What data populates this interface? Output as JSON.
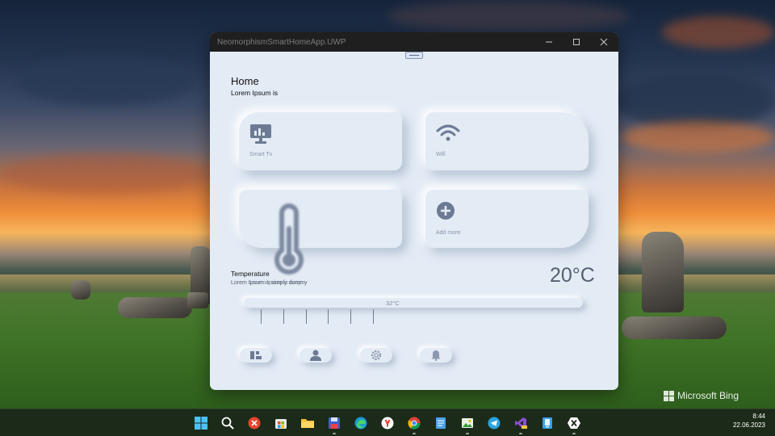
{
  "window": {
    "title": "NeomorphismSmartHomeApp.UWP",
    "controls": [
      "minimize-icon",
      "maximize-icon",
      "close-icon"
    ]
  },
  "page": {
    "title": "Home",
    "subtitle": "Lorem Ipsum is"
  },
  "cards": [
    {
      "label": "Smart Tv",
      "icon": "monitor-chart-icon"
    },
    {
      "label": "Wifi",
      "icon": "wifi-icon"
    },
    {
      "label": "",
      "icon": "thermometer-icon"
    },
    {
      "label": "Add more",
      "icon": "plus-circle-icon"
    }
  ],
  "temperature": {
    "title": "Temperature",
    "description": "Lorem Ipsum is simply dummy",
    "description_overlap": "Lorem Ipsum is simp",
    "current": "20°C",
    "slider_value": "32°C",
    "slider_fraction": 0.43
  },
  "bottom_nav": [
    {
      "icon": "apps-icon"
    },
    {
      "icon": "user-icon"
    },
    {
      "icon": "settings-icon"
    },
    {
      "icon": "bell-icon"
    }
  ],
  "desktop": {
    "watermark": "Microsoft Bing"
  },
  "taskbar": {
    "apps": [
      "windows-start-icon",
      "search-icon",
      "remote-desktop-icon",
      "microsoft-store-icon",
      "file-explorer-icon",
      "save-app-icon",
      "edge-icon",
      "yandex-browser-icon",
      "chrome-icon",
      "notepad-icon",
      "image-editor-icon",
      "telegram-icon",
      "visual-studio-preview-icon",
      "mobile-app-icon",
      "xamarin-icon"
    ],
    "time": "8:44",
    "date": "22.06.2023"
  },
  "colors": {
    "app_background": "#e3ebf5",
    "icon_color": "#6c7a94",
    "title_bar": "#1f1f1f",
    "taskbar": "#1c2a19"
  }
}
